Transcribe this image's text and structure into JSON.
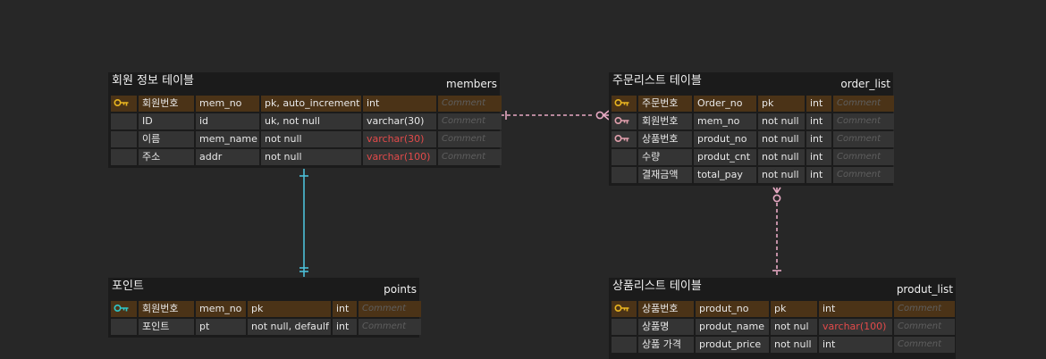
{
  "colors": {
    "pk_key": "#e9b520",
    "fk_key": "#e2a0ad",
    "points_key": "#2fc7c9",
    "relation_blue": "#4cbfd8",
    "relation_pink": "#e7a9c3"
  },
  "tables": [
    {
      "name": "회원 정보 테이블",
      "id": "members",
      "rows": [
        {
          "key": "pk-key-icon",
          "label": "회원번호",
          "column": "mem_no",
          "constraint": "pk, auto_increment",
          "type": "int",
          "comment": "Comment"
        },
        {
          "key": "",
          "label": "ID",
          "column": "id",
          "constraint": "uk, not null",
          "type": "varchar(30)",
          "comment": "Comment"
        },
        {
          "key": "",
          "label": "이름",
          "column": "mem_name",
          "constraint": "not null",
          "type": "varchar(30)",
          "comment": "Comment",
          "type_highlight": true
        },
        {
          "key": "",
          "label": "주소",
          "column": "addr",
          "constraint": "not null",
          "type": "varchar(100)",
          "comment": "Comment",
          "type_highlight": true
        }
      ]
    },
    {
      "name": "주문리스트 테이블",
      "id": "order_list",
      "rows": [
        {
          "key": "pk-key-icon",
          "label": "주문번호",
          "column": "Order_no",
          "constraint": "pk",
          "type": "int",
          "comment": "Comment"
        },
        {
          "key": "fk-key-icon",
          "label": "회원번호",
          "column": "mem_no",
          "constraint": "not null",
          "type": "int",
          "comment": "Comment"
        },
        {
          "key": "fk-key-icon",
          "label": "상품번호",
          "column": "produt_no",
          "constraint": "not null",
          "type": "int",
          "comment": "Comment"
        },
        {
          "key": "",
          "label": "수량",
          "column": "produt_cnt",
          "constraint": "not null",
          "type": "int",
          "comment": "Comment"
        },
        {
          "key": "",
          "label": "결재금액",
          "column": "total_pay",
          "constraint": "not null",
          "type": "int",
          "comment": "Comment"
        }
      ]
    },
    {
      "name": "포인트",
      "id": "points",
      "rows": [
        {
          "key": "points-key-icon",
          "label": "회원번호",
          "column": "mem_no",
          "constraint": "pk",
          "type": "int",
          "comment": "Comment"
        },
        {
          "key": "",
          "label": "포인트",
          "column": "pt",
          "constraint": "not null, defaulf",
          "type": "int",
          "comment": "Comment"
        }
      ]
    },
    {
      "name": "상품리스트 테이블",
      "id": "produt_list",
      "rows": [
        {
          "key": "pk-key-icon",
          "label": "상품번호",
          "column": "produt_no",
          "constraint": "pk",
          "type": "int",
          "comment": "Comment"
        },
        {
          "key": "",
          "label": "상품명",
          "column": "produt_name",
          "constraint": "not nul",
          "type": "varchar(100)",
          "comment": "Comment",
          "type_highlight": true
        },
        {
          "key": "",
          "label": "상품 가격",
          "column": "produt_price",
          "constraint": "not null",
          "type": "int",
          "comment": "Comment"
        }
      ]
    }
  ]
}
